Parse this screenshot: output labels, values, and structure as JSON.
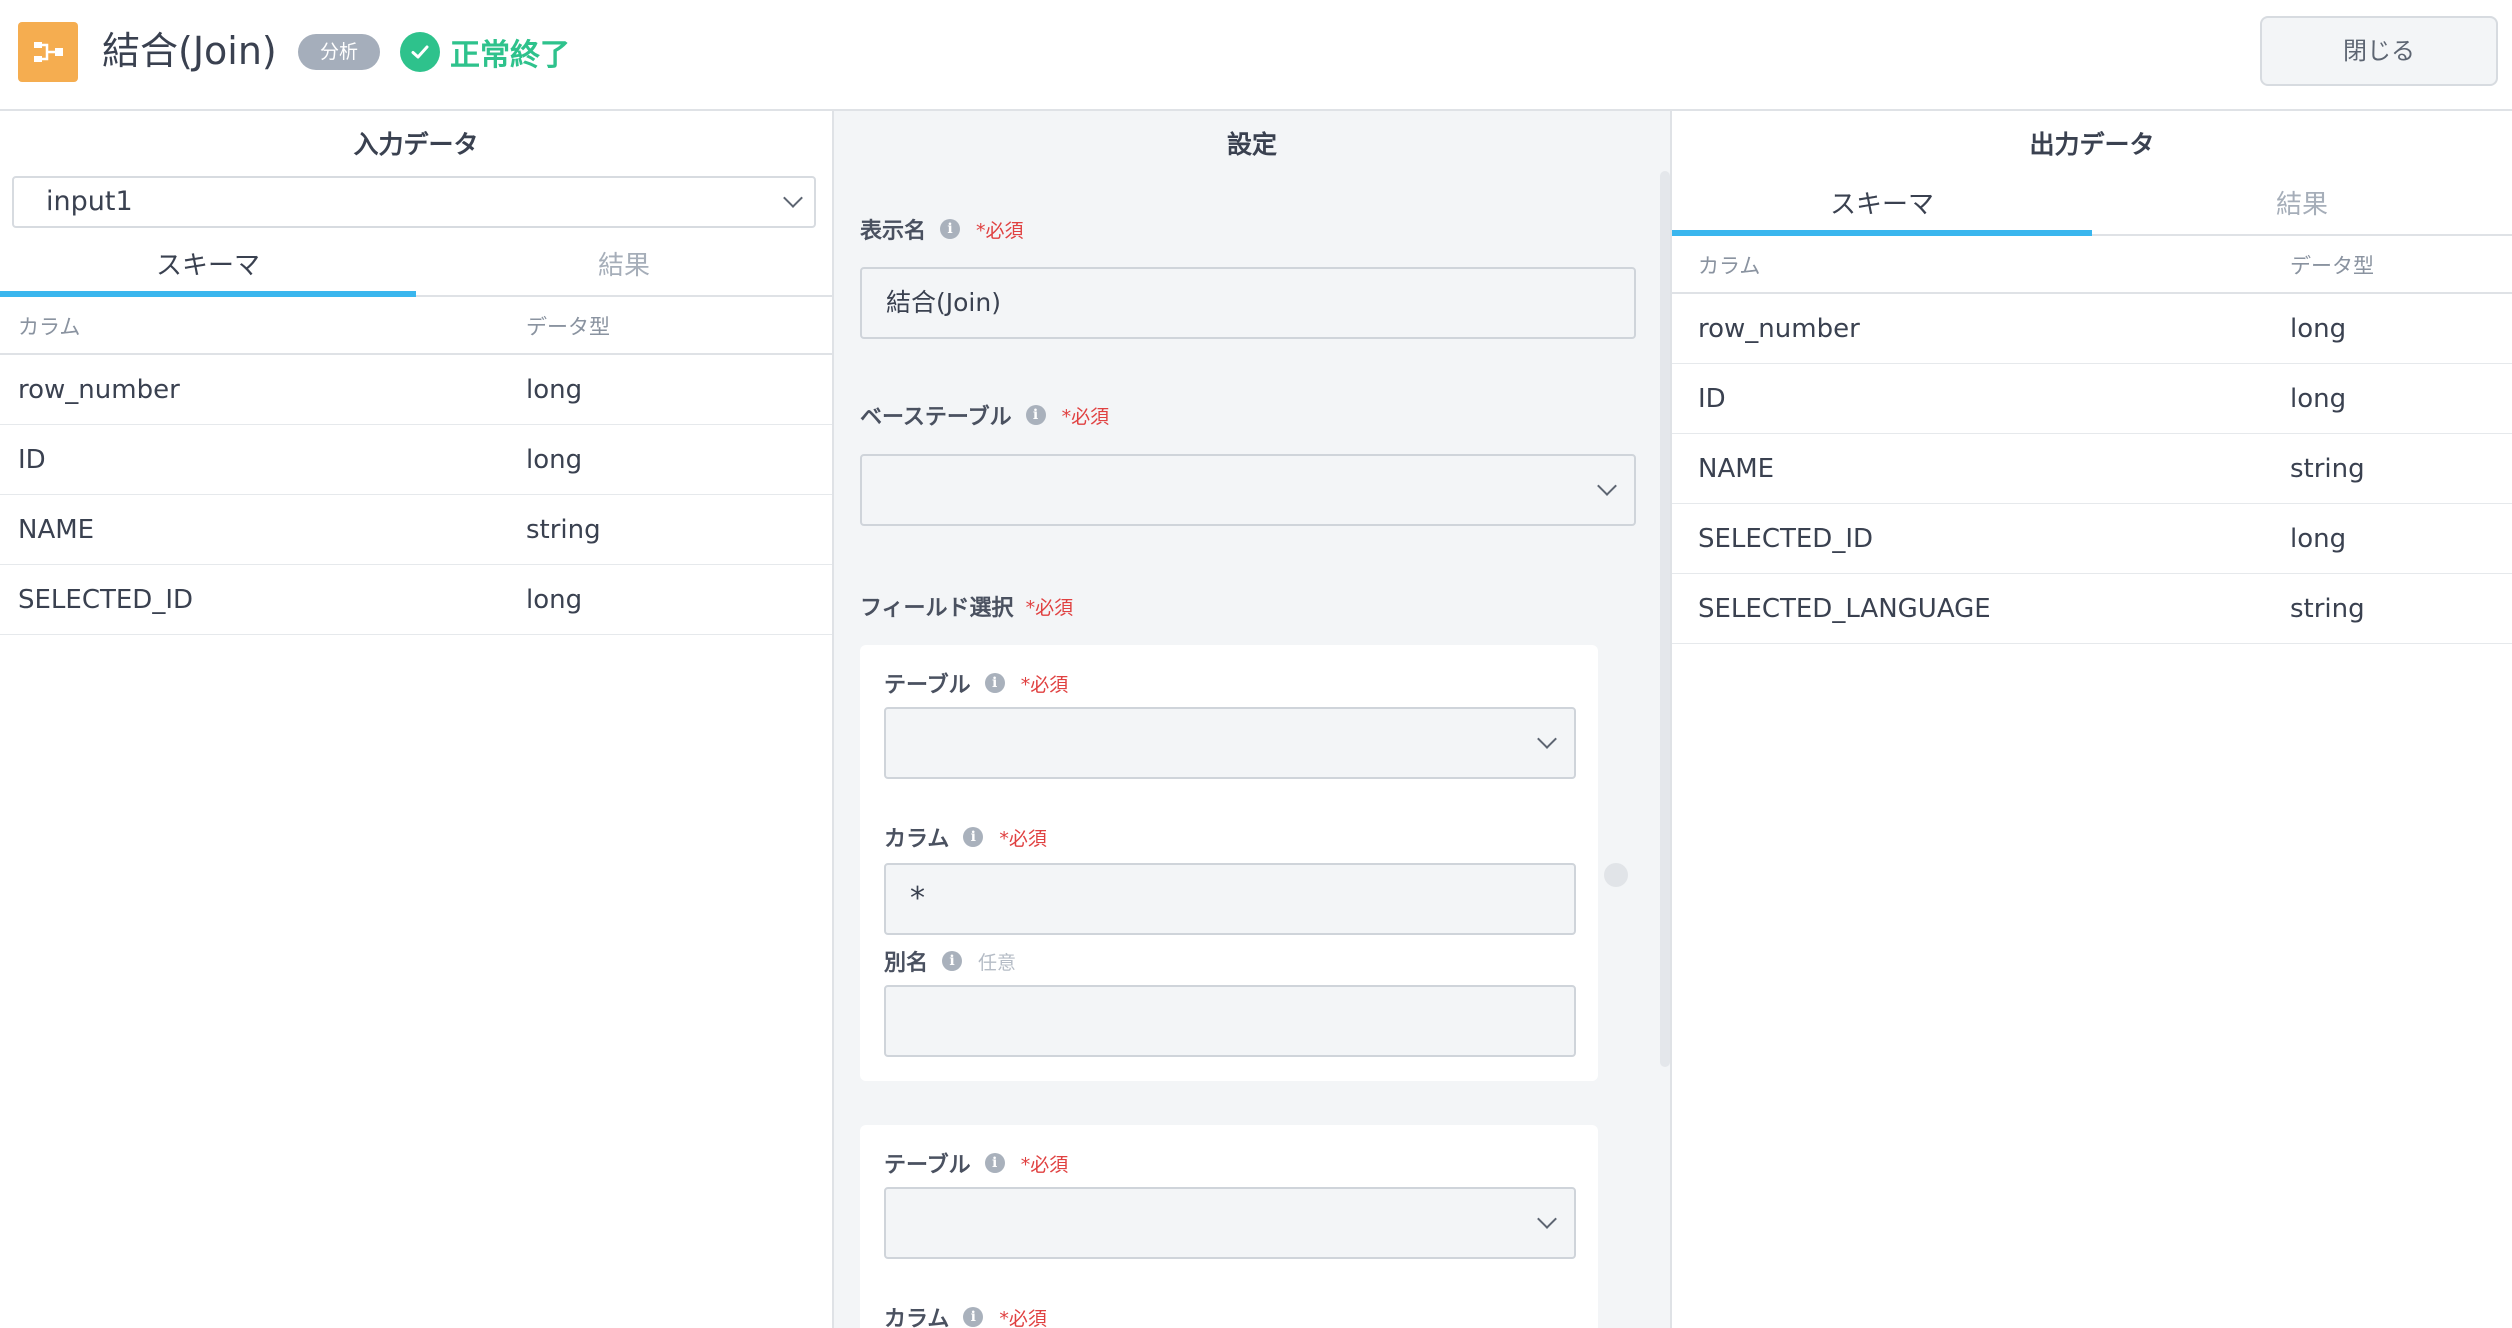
{
  "header": {
    "title": "結合(Join)",
    "category_badge": "分析",
    "status_text": "正常終了",
    "close_label": "閉じる",
    "colors": {
      "node_icon": "#f5ad50",
      "status": "#2ec28c",
      "accent": "#3ab6ee"
    }
  },
  "input_panel": {
    "title": "入力データ",
    "selected_input": "input1",
    "tabs": [
      {
        "label": "スキーマ",
        "active": true
      },
      {
        "label": "結果",
        "active": false
      }
    ],
    "columns": {
      "name": "カラム",
      "type": "データ型"
    },
    "rows": [
      {
        "name": "row_number",
        "type": "long"
      },
      {
        "name": "ID",
        "type": "long"
      },
      {
        "name": "NAME",
        "type": "string"
      },
      {
        "name": "SELECTED_ID",
        "type": "long"
      }
    ]
  },
  "settings_panel": {
    "title": "設定",
    "display_name": {
      "label": "表示名",
      "required": "*必須",
      "value": "結合(Join)"
    },
    "base_table": {
      "label": "ベーステーブル",
      "required": "*必須",
      "value": ""
    },
    "field_select": {
      "label": "フィールド選択",
      "required": "*必須",
      "cards": [
        {
          "table": {
            "label": "テーブル",
            "required": "*必須",
            "value": ""
          },
          "column": {
            "label": "カラム",
            "required": "*必須",
            "value": "*"
          },
          "alias": {
            "label": "別名",
            "optional": "任意",
            "value": ""
          }
        },
        {
          "table": {
            "label": "テーブル",
            "required": "*必須",
            "value": ""
          },
          "column": {
            "label": "カラム",
            "required": "*必須"
          }
        }
      ]
    }
  },
  "output_panel": {
    "title": "出力データ",
    "tabs": [
      {
        "label": "スキーマ",
        "active": true
      },
      {
        "label": "結果",
        "active": false
      }
    ],
    "columns": {
      "name": "カラム",
      "type": "データ型"
    },
    "rows": [
      {
        "name": "row_number",
        "type": "long"
      },
      {
        "name": "ID",
        "type": "long"
      },
      {
        "name": "NAME",
        "type": "string"
      },
      {
        "name": "SELECTED_ID",
        "type": "long"
      },
      {
        "name": "SELECTED_LANGUAGE",
        "type": "string"
      }
    ]
  }
}
